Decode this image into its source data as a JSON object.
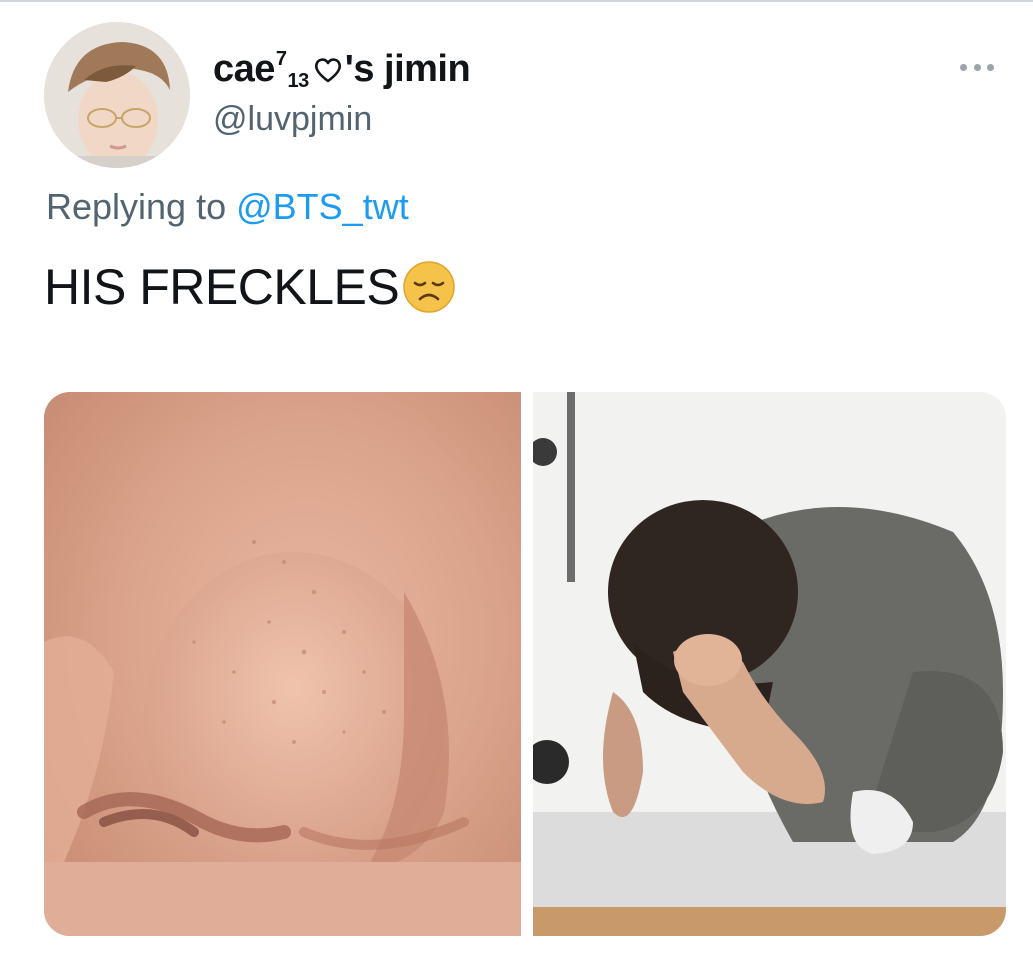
{
  "tweet": {
    "author": {
      "display_name_prefix": "cae",
      "display_name_sup": "7",
      "display_name_sub": "13",
      "display_name_suffix": "'s jimin",
      "handle": "@luvpjmin",
      "avatar_icon": "profile-photo-icon"
    },
    "menu_icon": "more-options-icon",
    "reply_prefix": "Replying to",
    "reply_mention": "@BTS_twt",
    "text": "HIS FRECKLES",
    "text_emoji": "disappointed-face-emoji",
    "media": [
      {
        "icon": "nose-closeup-photo"
      },
      {
        "icon": "person-crouching-photo"
      }
    ]
  },
  "colors": {
    "primary_text": "#111418",
    "secondary_text": "#536471",
    "mention": "#1d9bf0",
    "emoji_face": "#f5c24a"
  }
}
